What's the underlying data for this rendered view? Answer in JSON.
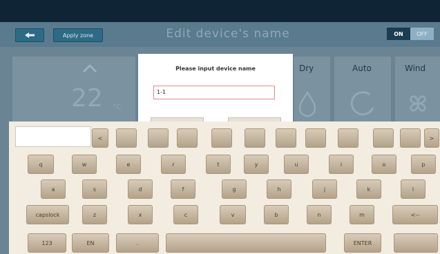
{
  "header": {
    "apply_zone_label": "Apply zone",
    "title": "Edit device's name",
    "toggle_on": "ON",
    "toggle_off": "OFF"
  },
  "background_panel": {
    "temperature": "22",
    "temperature_unit": "°C",
    "modes": [
      "Dry",
      "Auto",
      "Wind"
    ]
  },
  "dialog": {
    "prompt": "Please input device name",
    "input_value": "1-1"
  },
  "keyboard": {
    "row0_special": {
      "backspace_small": "<",
      "right_arrow": ">"
    },
    "row1": [
      "q",
      "w",
      "e",
      "r",
      "t",
      "y",
      "u",
      "i",
      "o",
      "p"
    ],
    "row2": [
      "a",
      "s",
      "d",
      "f",
      "g",
      "h",
      "j",
      "k",
      "l"
    ],
    "row3": {
      "caps": "capslock",
      "letters": [
        "z",
        "x",
        "c",
        "v",
        "b",
        "n",
        "m"
      ],
      "backspace": "<--"
    },
    "row4": {
      "num": "123",
      "lang": "EN",
      "dot": ".",
      "enter": "ENTER"
    }
  },
  "colors": {
    "header_bg": "#5a7a8d",
    "button_blue": "#2d6a86",
    "keyboard_bg": "#f3ece1",
    "key_tan": "#c7b89f",
    "input_border": "#e08a8a"
  }
}
